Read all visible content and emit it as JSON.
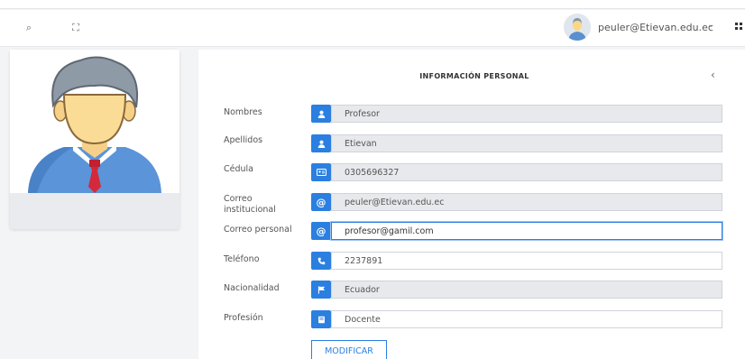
{
  "header": {
    "user_email": "peuler@Etievan.edu.ec",
    "caret": "⌄",
    "search_glyph": "⌕",
    "fullscreen_glyph": "⛶"
  },
  "profile": {
    "title": "INFORMACIÓN PERSONAL",
    "collapse_glyph": "‹",
    "fields": [
      {
        "label": "Nombres",
        "value": "Profesor",
        "icon": "user-icon",
        "editable": false
      },
      {
        "label": "Apellidos",
        "value": "Etievan",
        "icon": "user-icon",
        "editable": false
      },
      {
        "label": "Cédula",
        "value": "0305696327",
        "icon": "id-card-icon",
        "editable": false
      },
      {
        "label": "Correo institucional",
        "value": "peuler@Etievan.edu.ec",
        "icon": "at-icon",
        "editable": false
      },
      {
        "label": "Correo personal",
        "value": "profesor@gamil.com",
        "icon": "at-icon",
        "editable": true
      },
      {
        "label": "Teléfono",
        "value": "2237891",
        "icon": "phone-icon",
        "editable": true
      },
      {
        "label": "Nacionalidad",
        "value": "Ecuador",
        "icon": "flag-icon",
        "editable": false
      },
      {
        "label": "Profesión",
        "value": "Docente",
        "icon": "book-icon",
        "editable": true
      }
    ],
    "submit_label": "MODIFICAR"
  },
  "colors": {
    "accent": "#2b7fe0",
    "readonly": "#e7e9ed"
  }
}
